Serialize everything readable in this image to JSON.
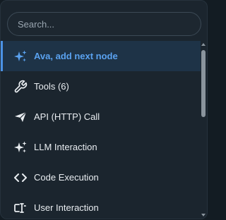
{
  "search": {
    "placeholder": "Search...",
    "value": ""
  },
  "colors": {
    "accent": "#4b93e6",
    "selected_text": "#5aa2f0",
    "selected_bg": "#1e3347",
    "panel_bg": "#1b252e",
    "text": "#e9edf1"
  },
  "items": [
    {
      "label": "Ava, add next node",
      "icon": "sparkles-icon",
      "selected": true
    },
    {
      "label": "Tools (6)",
      "icon": "wrench-icon",
      "selected": false
    },
    {
      "label": "API (HTTP) Call",
      "icon": "send-icon",
      "selected": false
    },
    {
      "label": "LLM Interaction",
      "icon": "sparkles-icon",
      "selected": false
    },
    {
      "label": "Code Execution",
      "icon": "code-icon",
      "selected": false
    },
    {
      "label": "User Interaction",
      "icon": "user-interaction-icon",
      "selected": false
    }
  ]
}
